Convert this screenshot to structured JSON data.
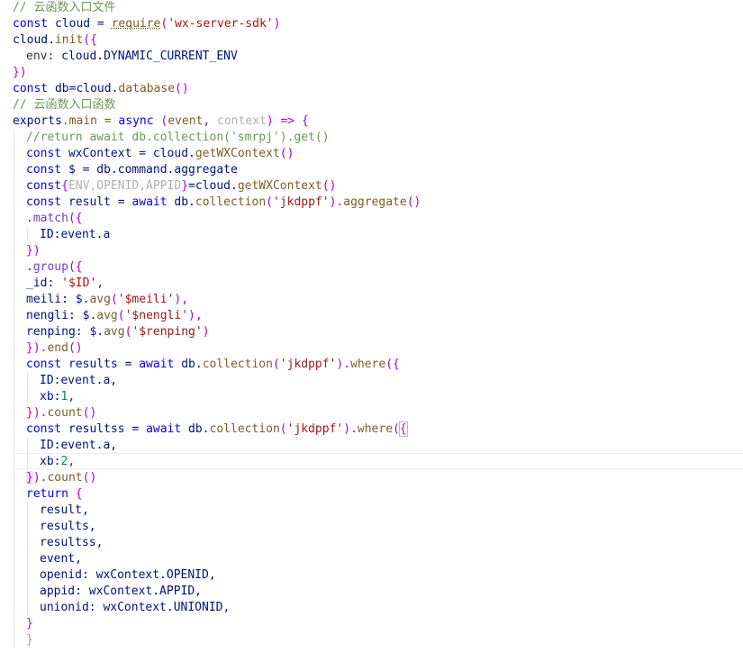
{
  "theme": {
    "background": "#ffffff",
    "comment": "#6a9955",
    "keyword": "#0000ff",
    "variable": "#001080",
    "string": "#a31515",
    "function": "#795e26",
    "number": "#098658",
    "bracket": "#af00db",
    "muted": "#b0b0b0"
  },
  "editor": {
    "lines": [
      {
        "indent": 0,
        "tokens": [
          {
            "t": "// 云函数入口文件",
            "k": "c"
          }
        ]
      },
      {
        "indent": 0,
        "tokens": [
          {
            "t": "const",
            "k": "k"
          },
          {
            "t": " cloud = ",
            "k": "v"
          },
          {
            "t": "require",
            "k": "u"
          },
          {
            "t": "(",
            "k": "b"
          },
          {
            "t": "'wx-server-sdk'",
            "k": "s"
          },
          {
            "t": ")",
            "k": "b"
          }
        ]
      },
      {
        "indent": 0,
        "tokens": [
          {
            "t": "cloud.",
            "k": "v"
          },
          {
            "t": "init",
            "k": "f"
          },
          {
            "t": "({",
            "k": "b"
          }
        ]
      },
      {
        "indent": 1,
        "tokens": [
          {
            "t": "env: ",
            "k": "p"
          },
          {
            "t": "cloud.DYNAMIC_CURRENT_ENV",
            "k": "v"
          }
        ]
      },
      {
        "indent": 0,
        "tokens": [
          {
            "t": "})",
            "k": "b"
          }
        ]
      },
      {
        "indent": 0,
        "tokens": [
          {
            "t": "const",
            "k": "k"
          },
          {
            "t": " db=cloud.",
            "k": "v"
          },
          {
            "t": "database",
            "k": "f"
          },
          {
            "t": "()",
            "k": "b"
          }
        ]
      },
      {
        "indent": 0,
        "tokens": [
          {
            "t": "// 云函数入口函数",
            "k": "c"
          }
        ]
      },
      {
        "indent": 0,
        "tokens": [
          {
            "t": "exports",
            "k": "v"
          },
          {
            "t": ".main = ",
            "k": "f"
          },
          {
            "t": "async",
            "k": "k"
          },
          {
            "t": " (",
            "k": "b"
          },
          {
            "t": "event",
            "k": "f"
          },
          {
            "t": ", ",
            "k": "p"
          },
          {
            "t": "context",
            "k": "m"
          },
          {
            "t": ") => {",
            "k": "b"
          }
        ]
      },
      {
        "indent": 1,
        "tokens": [
          {
            "t": "//return await db.collection('smrpj').get()",
            "k": "c"
          }
        ]
      },
      {
        "indent": 1,
        "tokens": [
          {
            "t": "const",
            "k": "k"
          },
          {
            "t": " wxContext = cloud.",
            "k": "v"
          },
          {
            "t": "getWXContext",
            "k": "f"
          },
          {
            "t": "()",
            "k": "b"
          }
        ]
      },
      {
        "indent": 1,
        "tokens": [
          {
            "t": "const",
            "k": "k"
          },
          {
            "t": " $ = db.command.aggregate",
            "k": "v"
          }
        ]
      },
      {
        "indent": 1,
        "tokens": [
          {
            "t": "const",
            "k": "k"
          },
          {
            "t": "{",
            "k": "b"
          },
          {
            "t": "ENV,OPENID,APPID",
            "k": "m"
          },
          {
            "t": "}",
            "k": "b"
          },
          {
            "t": "=cloud.",
            "k": "v"
          },
          {
            "t": "getWXContext",
            "k": "f"
          },
          {
            "t": "()",
            "k": "b"
          }
        ]
      },
      {
        "indent": 1,
        "tokens": [
          {
            "t": "const",
            "k": "k"
          },
          {
            "t": " result = ",
            "k": "v"
          },
          {
            "t": "await",
            "k": "k"
          },
          {
            "t": " db.",
            "k": "v"
          },
          {
            "t": "collection",
            "k": "f"
          },
          {
            "t": "(",
            "k": "b"
          },
          {
            "t": "'jkdppf'",
            "k": "s"
          },
          {
            "t": ").",
            "k": "b"
          },
          {
            "t": "aggregate",
            "k": "f"
          },
          {
            "t": "()",
            "k": "b"
          }
        ]
      },
      {
        "indent": 1,
        "tokens": [
          {
            "t": ".",
            "k": "p"
          },
          {
            "t": "match",
            "k": "y"
          },
          {
            "t": "({",
            "k": "b"
          }
        ]
      },
      {
        "indent": 2,
        "tokens": [
          {
            "t": "ID:event.a",
            "k": "v"
          }
        ]
      },
      {
        "indent": 1,
        "tokens": [
          {
            "t": "})",
            "k": "b"
          }
        ]
      },
      {
        "indent": 1,
        "tokens": [
          {
            "t": ".",
            "k": "p"
          },
          {
            "t": "group",
            "k": "y"
          },
          {
            "t": "({",
            "k": "b"
          }
        ]
      },
      {
        "indent": 1,
        "tokens": [
          {
            "t": "_id: ",
            "k": "v"
          },
          {
            "t": "'$ID'",
            "k": "s"
          },
          {
            "t": ",",
            "k": "p"
          }
        ]
      },
      {
        "indent": 1,
        "tokens": [
          {
            "t": "meili: $.",
            "k": "v"
          },
          {
            "t": "avg",
            "k": "f"
          },
          {
            "t": "(",
            "k": "b"
          },
          {
            "t": "'$meili'",
            "k": "s"
          },
          {
            "t": "),",
            "k": "b"
          }
        ]
      },
      {
        "indent": 1,
        "tokens": [
          {
            "t": "nengli: $.",
            "k": "v"
          },
          {
            "t": "avg",
            "k": "f"
          },
          {
            "t": "(",
            "k": "b"
          },
          {
            "t": "'$nengli'",
            "k": "s"
          },
          {
            "t": "),",
            "k": "b"
          }
        ]
      },
      {
        "indent": 1,
        "tokens": [
          {
            "t": "renping: $.",
            "k": "v"
          },
          {
            "t": "avg",
            "k": "f"
          },
          {
            "t": "(",
            "k": "b"
          },
          {
            "t": "'$renping'",
            "k": "s"
          },
          {
            "t": ")",
            "k": "b"
          }
        ]
      },
      {
        "indent": 1,
        "tokens": [
          {
            "t": "}).",
            "k": "b"
          },
          {
            "t": "end",
            "k": "f"
          },
          {
            "t": "()",
            "k": "b"
          }
        ]
      },
      {
        "indent": 1,
        "tokens": [
          {
            "t": "const",
            "k": "k"
          },
          {
            "t": " results = ",
            "k": "v"
          },
          {
            "t": "await",
            "k": "k"
          },
          {
            "t": " db.",
            "k": "v"
          },
          {
            "t": "collection",
            "k": "f"
          },
          {
            "t": "(",
            "k": "b"
          },
          {
            "t": "'jkdppf'",
            "k": "s"
          },
          {
            "t": ").",
            "k": "b"
          },
          {
            "t": "where",
            "k": "f"
          },
          {
            "t": "({",
            "k": "b"
          }
        ]
      },
      {
        "indent": 2,
        "tokens": [
          {
            "t": "ID:event.a,",
            "k": "v"
          }
        ]
      },
      {
        "indent": 2,
        "tokens": [
          {
            "t": "xb:",
            "k": "v"
          },
          {
            "t": "1",
            "k": "n"
          },
          {
            "t": ",",
            "k": "p"
          }
        ]
      },
      {
        "indent": 1,
        "tokens": [
          {
            "t": "}).",
            "k": "b"
          },
          {
            "t": "count",
            "k": "f"
          },
          {
            "t": "()",
            "k": "b"
          }
        ]
      },
      {
        "indent": 1,
        "tokens": [
          {
            "t": "const",
            "k": "k"
          },
          {
            "t": " resultss = ",
            "k": "v"
          },
          {
            "t": "await",
            "k": "k"
          },
          {
            "t": " db.",
            "k": "v"
          },
          {
            "t": "collection",
            "k": "f"
          },
          {
            "t": "(",
            "k": "b"
          },
          {
            "t": "'jkdppf'",
            "k": "s"
          },
          {
            "t": ").",
            "k": "b"
          },
          {
            "t": "where",
            "k": "f"
          },
          {
            "t": "(",
            "k": "b"
          },
          {
            "t": "{",
            "k": "h"
          }
        ]
      },
      {
        "indent": 2,
        "tokens": [
          {
            "t": "ID:event.a,",
            "k": "v"
          }
        ]
      },
      {
        "indent": 2,
        "tokens": [
          {
            "t": "xb:",
            "k": "v"
          },
          {
            "t": "2",
            "k": "n"
          },
          {
            "t": ",",
            "k": "p"
          }
        ]
      },
      {
        "indent": 1,
        "tokens": [
          {
            "t": "}",
            "k": "h2"
          },
          {
            "t": ").",
            "k": "b"
          },
          {
            "t": "count",
            "k": "f"
          },
          {
            "t": "()",
            "k": "b"
          }
        ]
      },
      {
        "indent": 1,
        "tokens": [
          {
            "t": "return",
            "k": "k"
          },
          {
            "t": " {",
            "k": "b"
          }
        ]
      },
      {
        "indent": 2,
        "tokens": [
          {
            "t": "result,",
            "k": "v"
          }
        ]
      },
      {
        "indent": 2,
        "tokens": [
          {
            "t": "results,",
            "k": "v"
          }
        ]
      },
      {
        "indent": 2,
        "tokens": [
          {
            "t": "resultss,",
            "k": "v"
          }
        ]
      },
      {
        "indent": 2,
        "tokens": [
          {
            "t": "event,",
            "k": "v"
          }
        ]
      },
      {
        "indent": 2,
        "tokens": [
          {
            "t": "openid: wxContext.OPENID,",
            "k": "v"
          }
        ]
      },
      {
        "indent": 2,
        "tokens": [
          {
            "t": "appid: wxContext.APPID,",
            "k": "v"
          }
        ]
      },
      {
        "indent": 2,
        "tokens": [
          {
            "t": "unionid: wxContext.UNIONID,",
            "k": "v"
          }
        ]
      },
      {
        "indent": 1,
        "tokens": [
          {
            "t": "}",
            "k": "b"
          }
        ]
      },
      {
        "indent": 1,
        "tokens": [
          {
            "t": "}",
            "k": "x"
          }
        ]
      }
    ]
  }
}
